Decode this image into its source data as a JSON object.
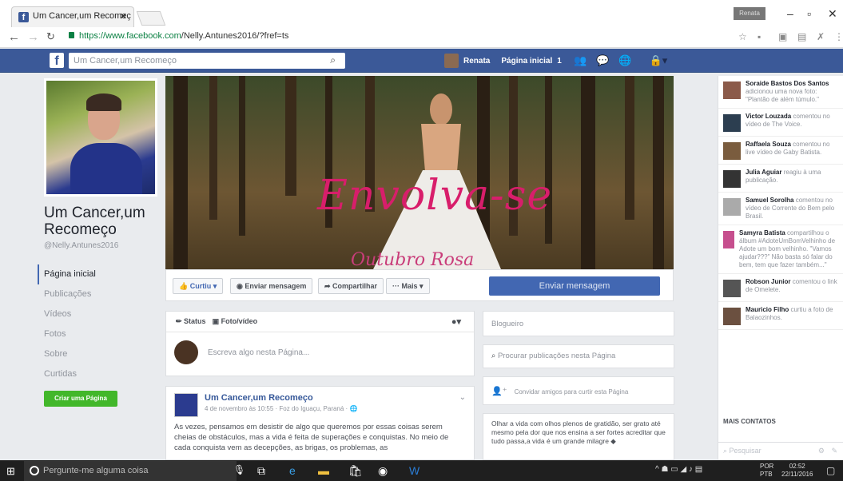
{
  "browser": {
    "tab_title": "Um Cancer,um Recomeç",
    "tab_close": "✕",
    "profile_button": "Renata",
    "url_host": "https://www.facebook.com",
    "url_path": "/Nelly.Antunes2016/?fref=ts"
  },
  "fb_header": {
    "search_value": "Um Cancer,um Recomeço",
    "user_name": "Renata",
    "home_label": "Página inicial",
    "home_count": "1"
  },
  "page": {
    "name": "Um Cancer,um Recomeço",
    "handle": "@Nelly.Antunes2016",
    "nav": [
      "Página inicial",
      "Publicações",
      "Vídeos",
      "Fotos",
      "Sobre",
      "Curtidas"
    ],
    "create_page": "Criar uma Página",
    "cover_title": "Envolva-se",
    "cover_subtitle": "Outubro Rosa"
  },
  "actions": {
    "like": "Curtiu ▾",
    "message": "Enviar mensagem",
    "share": "Compartilhar",
    "more": "··· Mais ▾",
    "send_message_big": "Enviar mensagem"
  },
  "composer": {
    "status": "Status",
    "photo_video": "Foto/vídeo",
    "placeholder": "Escreva algo nesta Página..."
  },
  "post": {
    "author": "Um Cancer,um Recomeço",
    "meta": "4 de novembro às 10:55 · Foz do Iguaçu, Paraná · 🌐",
    "text": "As vezes, pensamos em desistir de algo que queremos por essas coisas serem cheias de obstáculos, mas a vida é feita de superações e conquistas. No meio de cada conquista vem as decepções, as brigas, os problemas, as"
  },
  "right_widgets": {
    "category": "Blogueiro",
    "search_posts": "Procurar publicações nesta Página",
    "invite_friends": "Convidar amigos para curtir esta Página",
    "about_text": "Olhar a vida com olhos plenos de gratidão, ser grato até mesmo pela dor que nos ensina a ser fortes acreditar que tudo passa,a vida é um grande milagre ◆"
  },
  "ticker": [
    {
      "name": "Soraide Bastos Dos Santos",
      "action": "adicionou uma nova foto: \"Plantão de além túmulo.\""
    },
    {
      "name": "Victor Louzada",
      "action": "comentou no vídeo de The Voice."
    },
    {
      "name": "Raffaela Souza",
      "action": "comentou no live vídeo de Gaby Batista."
    },
    {
      "name": "Julia Aguiar",
      "action": "reagiu à uma publicação."
    },
    {
      "name": "Samuel Sorolha",
      "action": "comentou no vídeo de Corrente do Bem pelo Brasil."
    },
    {
      "name": "Samyra Batista",
      "action": "compartilhou o álbum #AdoteUmBomVelhinho de Adote um bom velhinho. \"Vamos ajudar???\" Não basta só falar do bem, tem que fazer também...\""
    },
    {
      "name": "Robson Junior",
      "action": "comentou o link de Omelete."
    },
    {
      "name": "Mauricio Filho",
      "action": "curtiu a foto de Balaozinhos."
    }
  ],
  "contacts": {
    "title": "MAIS CONTATOS",
    "search": "Pesquisar"
  },
  "taskbar": {
    "search": "Pergunte-me alguma coisa",
    "lang1": "POR",
    "lang2": "PTB",
    "time": "02:52",
    "date": "22/11/2016"
  }
}
